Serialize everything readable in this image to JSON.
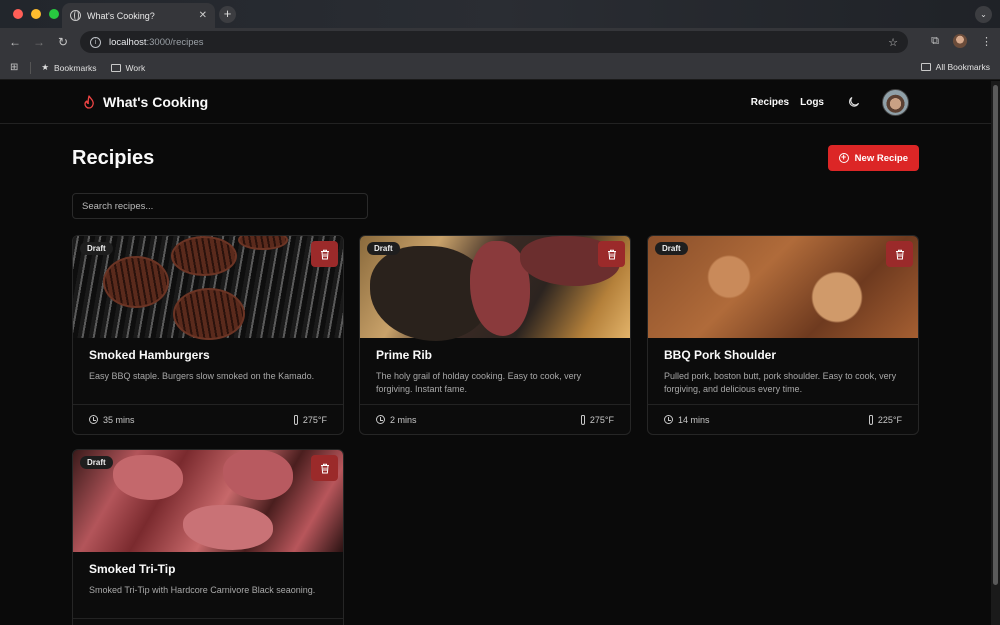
{
  "browser": {
    "tab_title": "What's Cooking?",
    "url_host": "localhost",
    "url_path": ":3000/recipes",
    "bookmarks": [
      {
        "label": "Bookmarks"
      },
      {
        "label": "Work"
      }
    ],
    "all_bookmarks": "All Bookmarks"
  },
  "nav": {
    "brand": "What's Cooking",
    "links": [
      {
        "label": "Recipes"
      },
      {
        "label": "Logs"
      }
    ]
  },
  "page": {
    "title": "Recipies",
    "new_button": "New Recipe",
    "search_placeholder": "Search recipes..."
  },
  "colors": {
    "accent": "#dc2626",
    "background": "#0a0a0a"
  },
  "recipes": [
    {
      "title": "Smoked Hamburgers",
      "description": "Easy BBQ staple. Burgers slow smoked on the Kamado.",
      "badge": "Draft",
      "time": "35 mins",
      "temp": "275°F"
    },
    {
      "title": "Prime Rib",
      "description": "The holy grail of holday cooking. Easy to cook, very forgiving. Instant fame.",
      "badge": "Draft",
      "time": "2 mins",
      "temp": "275°F"
    },
    {
      "title": "BBQ Pork Shoulder",
      "description": "Pulled pork, boston butt, pork shoulder. Easy to cook, very forgiving, and delicious every time.",
      "badge": "Draft",
      "time": "14 mins",
      "temp": "225°F"
    },
    {
      "title": "Smoked Tri-Tip",
      "description": "Smoked Tri-Tip with Hardcore Carnivore Black seaoning.",
      "badge": "Draft",
      "time": "",
      "temp": ""
    }
  ]
}
